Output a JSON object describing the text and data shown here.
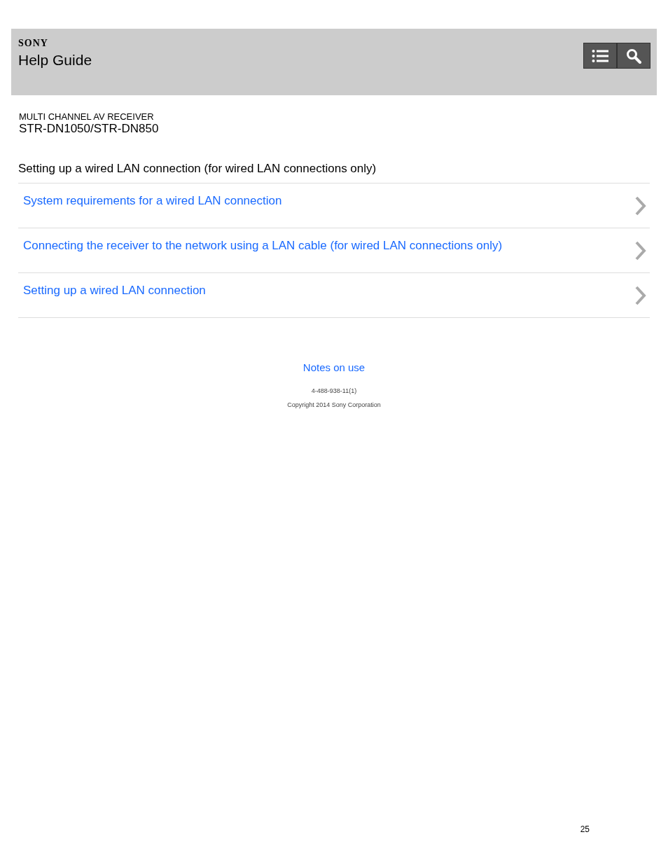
{
  "header": {
    "brand": "SONY",
    "title": "Help Guide",
    "buttons": [
      {
        "kind": "toc"
      },
      {
        "kind": "search"
      }
    ]
  },
  "product": {
    "category": "MULTI CHANNEL AV RECEIVER",
    "model": "STR-DN1050/STR-DN850"
  },
  "section": {
    "title": "Setting up a wired LAN connection (for wired LAN connections only)",
    "links": [
      "System requirements for a wired LAN connection",
      "Connecting the receiver to the network using a LAN cable (for wired LAN connections only)",
      "Setting up a wired LAN connection"
    ]
  },
  "footer": {
    "notes_link": "Notes on use",
    "code": "4-488-938-11(1)",
    "copyright": "Copyright 2014 Sony Corporation"
  },
  "page_number": "25"
}
